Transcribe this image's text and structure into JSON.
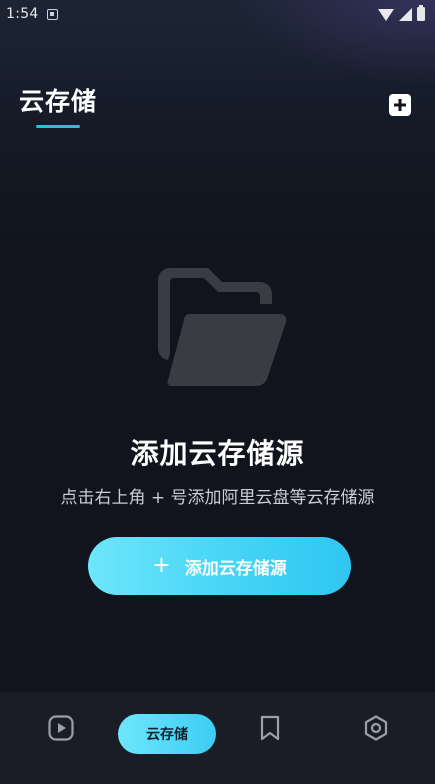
{
  "status_bar": {
    "time": "1:54",
    "icons": [
      "app-notification-icon",
      "wifi-icon",
      "signal-icon",
      "battery-icon"
    ]
  },
  "header": {
    "title": "云存储",
    "add_icon": "plus-square-icon",
    "accent_color": "#22c3dd"
  },
  "empty_state": {
    "icon": "folder-open-icon",
    "title": "添加云存储源",
    "subtitle": "点击右上角 + 号添加阿里云盘等云存储源",
    "button_plus": "+",
    "button_label": "添加云存储源"
  },
  "bottom_nav": {
    "items": [
      {
        "icon": "play-icon",
        "label": "",
        "active": false
      },
      {
        "icon": "cloud-storage",
        "label": "云存储",
        "active": true
      },
      {
        "icon": "bookmark-icon",
        "label": "",
        "active": false
      },
      {
        "icon": "settings-hexagon-icon",
        "label": "",
        "active": false
      }
    ]
  },
  "colors": {
    "background": "#11141c",
    "button_gradient_start": "#6ee6fb",
    "button_gradient_end": "#2fc6f1",
    "nav_background": "#1a1d25",
    "folder_icon": "#3a3b43"
  }
}
